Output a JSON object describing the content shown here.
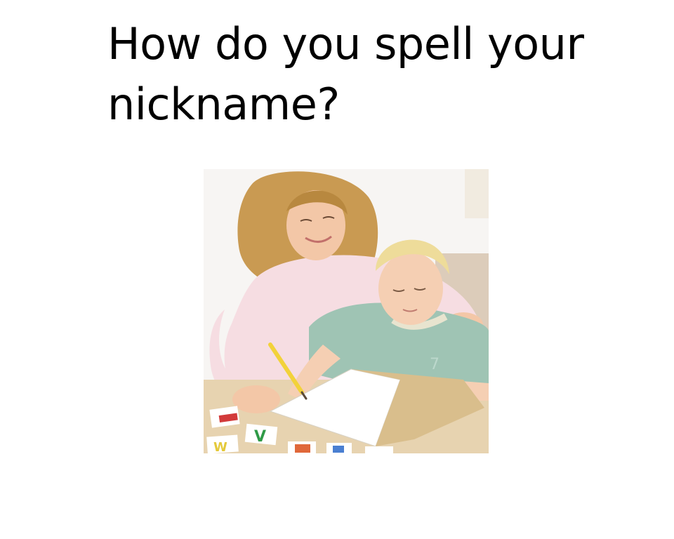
{
  "slide": {
    "title": "How do you spell your nickname?"
  },
  "photo": {
    "icon": "woman-helping-boy-write-photo",
    "colors": {
      "background": "#f7f5f3",
      "hair_woman": "#c99a52",
      "hair_boy": "#eedc9a",
      "shirt_woman": "#f6dde2",
      "shirt_boy": "#9fc4b4",
      "skin": "#f3c7a7",
      "table": "#e7d3b0",
      "paper": "#ffffff",
      "pencil": "#f2d23a"
    }
  }
}
